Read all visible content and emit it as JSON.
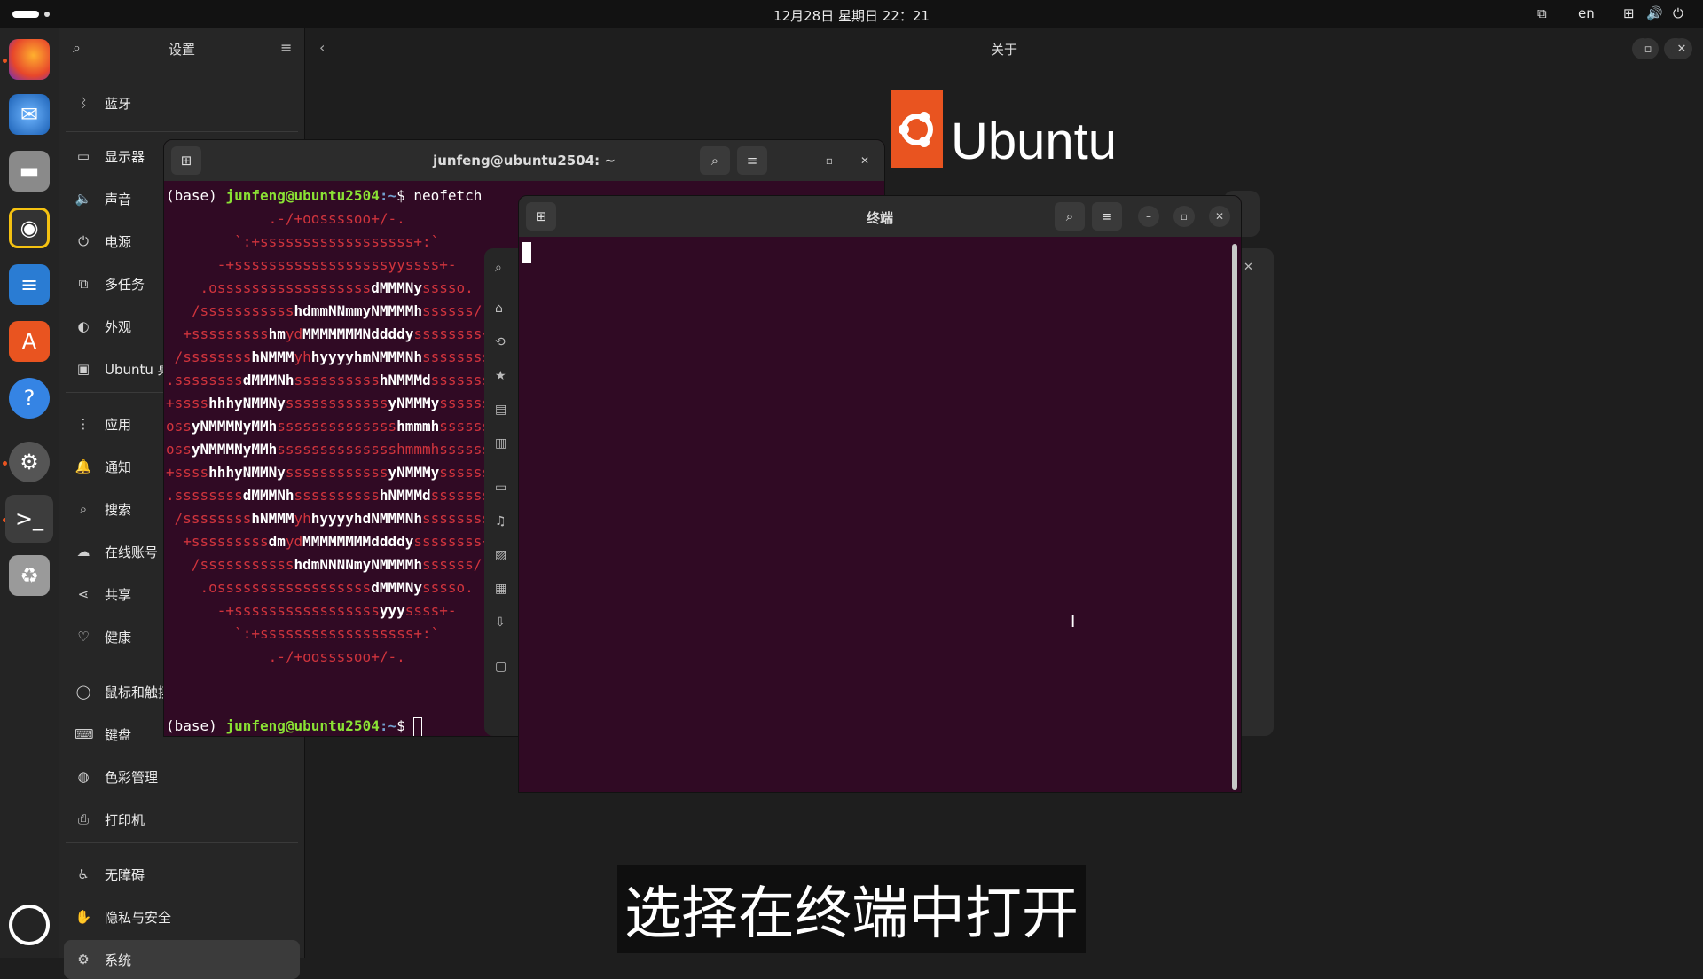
{
  "topbar": {
    "clock": "12月28日 星期日 22：21",
    "lang": "en"
  },
  "settings": {
    "title": "设置",
    "main_title": "关于",
    "sidebar": [
      {
        "label": "蓝牙",
        "icon": "bluetooth-icon"
      },
      {
        "label": "显示器",
        "icon": "display-icon"
      },
      {
        "label": "声音",
        "icon": "sound-icon"
      },
      {
        "label": "电源",
        "icon": "power-icon"
      },
      {
        "label": "多任务",
        "icon": "multitask-icon"
      },
      {
        "label": "外观",
        "icon": "appearance-icon"
      },
      {
        "label": "Ubuntu 桌",
        "icon": "ubuntu-desktop-icon"
      },
      {
        "label": "应用",
        "icon": "apps-icon"
      },
      {
        "label": "通知",
        "icon": "notification-icon"
      },
      {
        "label": "搜索",
        "icon": "search-icon"
      },
      {
        "label": "在线账号",
        "icon": "cloud-icon"
      },
      {
        "label": "共享",
        "icon": "share-icon"
      },
      {
        "label": "健康",
        "icon": "health-icon"
      },
      {
        "label": "鼠标和触摸",
        "icon": "mouse-icon"
      },
      {
        "label": "键盘",
        "icon": "keyboard-icon"
      },
      {
        "label": "色彩管理",
        "icon": "color-icon"
      },
      {
        "label": "打印机",
        "icon": "printer-icon"
      },
      {
        "label": "无障碍",
        "icon": "accessibility-icon"
      },
      {
        "label": "隐私与安全",
        "icon": "privacy-icon"
      },
      {
        "label": "系统",
        "icon": "gear-icon"
      }
    ],
    "logo_text": "Ubuntu"
  },
  "terminal1": {
    "title": "junfeng@ubuntu2504: ~",
    "cmd_prompt_base": "(base) ",
    "user_host": "junfeng@ubuntu2504",
    "path": ":~",
    "dollar": "$ ",
    "command": "neofetch"
  },
  "terminal2": {
    "title": "终端"
  },
  "subtitle": "选择在终端中打开"
}
